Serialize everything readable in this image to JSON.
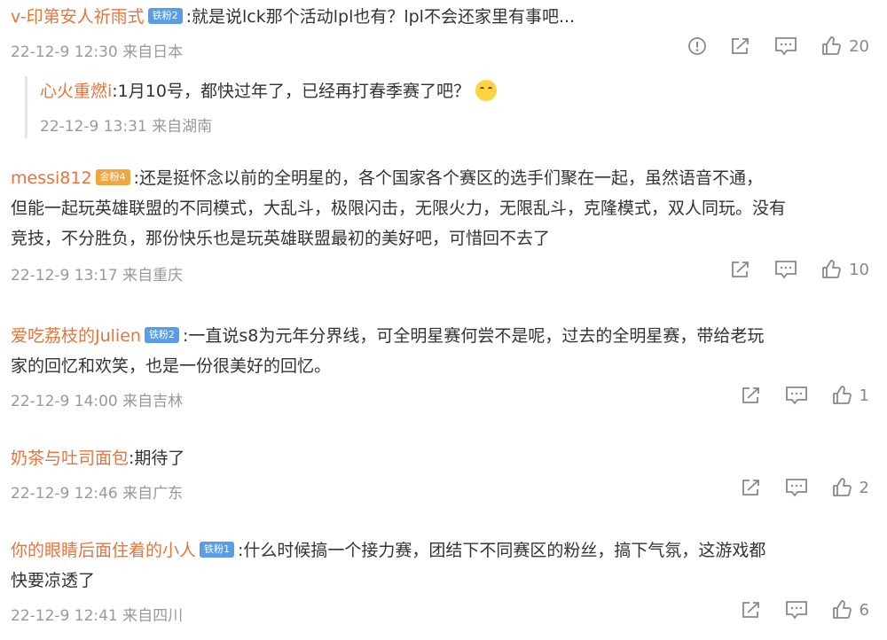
{
  "comments": [
    {
      "user": "v-印第安人祈雨式",
      "badge": "铁粉2",
      "text": ":就是说lck那个活动lpl也有？lpl不会还家里有事吧...",
      "meta": "22-12-9 12:30 来自日本",
      "likes": "20",
      "reply": {
        "user": "心火重燃i",
        "text": ":1月10号，都快过年了，已经再打春季赛了吧？",
        "meta": "22-12-9 13:31 来自湖南"
      }
    },
    {
      "user": "messi812",
      "badge": "金粉4",
      "text": ":还是挺怀念以前的全明星的，各个国家各个赛区的选手们聚在一起，虽然语音不通，",
      "text2": "但能一起玩英雄联盟的不同模式，大乱斗，极限闪击，无限火力，无限乱斗，克隆模式，双人同玩。没有",
      "text3": "竞技，不分胜负，那份快乐也是玩英雄联盟最初的美好吧，可惜回不去了",
      "meta": "22-12-9 13:17 来自重庆",
      "likes": "10"
    },
    {
      "user": "爱吃荔枝的Julien",
      "badge": "铁粉2",
      "text": ":一直说s8为元年分界线，可全明星赛何尝不是呢，过去的全明星赛，带给老玩",
      "text2": "家的回忆和欢笑，也是一份很美好的回忆。",
      "meta": "22-12-9 14:00 来自吉林",
      "likes": "1"
    },
    {
      "user": "奶茶与吐司面包",
      "text": ":期待了",
      "meta": "22-12-9 12:46 来自广东",
      "likes": "2"
    },
    {
      "user": "你的眼睛后面住着的小人",
      "badge": "铁粉1",
      "text": ":什么时候搞一个接力赛，团结下不同赛区的粉丝，搞下气氛，这游戏都",
      "text2": "快要凉透了",
      "meta": "22-12-9 12:41 来自四川",
      "likes": "6"
    }
  ],
  "icons": {
    "report": "report-icon",
    "share": "share-icon",
    "comment": "comment-icon",
    "like": "thumbs-up-icon"
  },
  "colors": {
    "username": "#e8743b",
    "meta": "#999999",
    "badge_blue": "#5a9de6",
    "badge_gold": "#f0a742"
  }
}
